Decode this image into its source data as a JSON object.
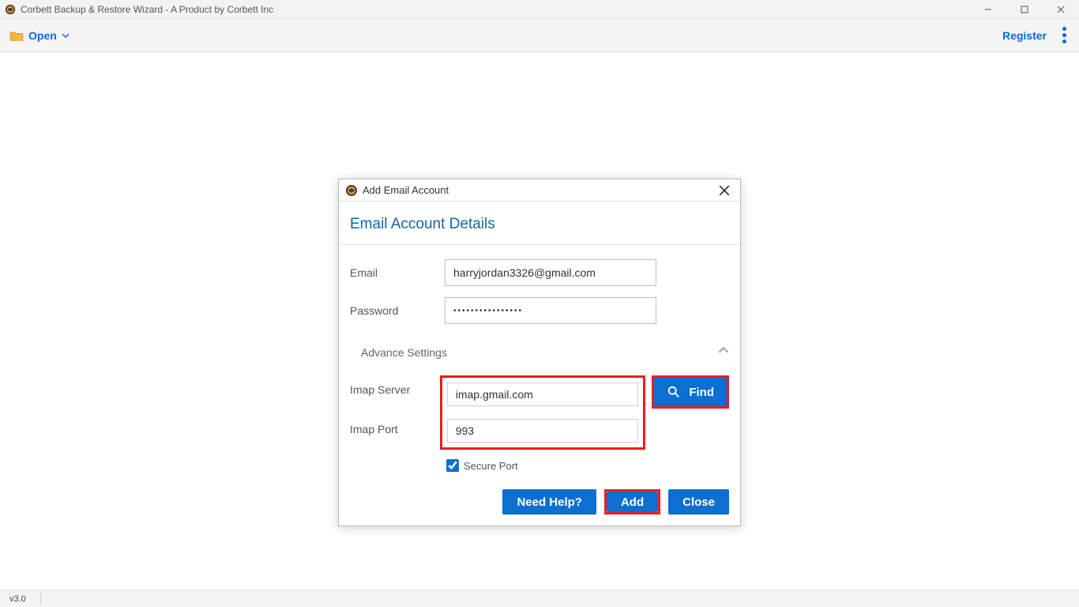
{
  "window": {
    "title": "Corbett Backup & Restore Wizard - A Product by Corbett Inc"
  },
  "toolbar": {
    "open_label": "Open",
    "register_label": "Register"
  },
  "statusbar": {
    "version": "v3.0"
  },
  "dialog": {
    "title": "Add Email Account",
    "heading": "Email Account Details",
    "labels": {
      "email": "Email",
      "password": "Password",
      "advance": "Advance Settings",
      "imap_server": "Imap Server",
      "imap_port": "Imap Port",
      "secure_port": "Secure Port"
    },
    "values": {
      "email": "harryjordan3326@gmail.com",
      "password_mask": "••••••••••••••••",
      "imap_server": "imap.gmail.com",
      "imap_port": "993",
      "secure_port_checked": true
    },
    "buttons": {
      "find": "Find",
      "need_help": "Need Help?",
      "add": "Add",
      "close": "Close"
    }
  }
}
